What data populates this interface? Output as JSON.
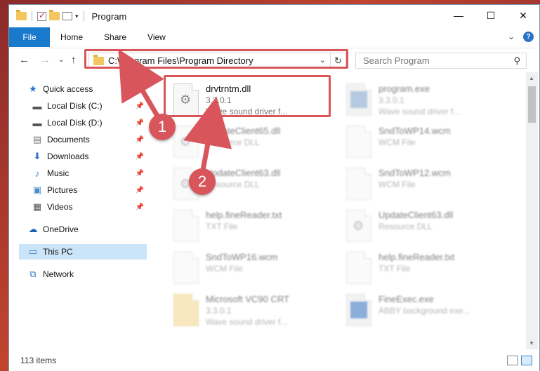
{
  "window": {
    "title": "Program",
    "controls": {
      "minimize": "—",
      "maximize": "☐",
      "close": "✕"
    }
  },
  "ribbon": {
    "file_tab": "File",
    "tabs": [
      "Home",
      "Share",
      "View"
    ]
  },
  "address": {
    "path": "C:\\Program Files\\Program Directory",
    "search_placeholder": "Search Program"
  },
  "nav": {
    "items": [
      {
        "label": "Quick access",
        "icon": "star-icon",
        "pinned": false
      },
      {
        "label": "Local Disk (C:)",
        "icon": "drive-icon",
        "pinned": true
      },
      {
        "label": "Local Disk (D:)",
        "icon": "drive-icon",
        "pinned": true
      },
      {
        "label": "Documents",
        "icon": "documents-icon",
        "pinned": true
      },
      {
        "label": "Downloads",
        "icon": "download-icon",
        "pinned": true
      },
      {
        "label": "Music",
        "icon": "music-icon",
        "pinned": true
      },
      {
        "label": "Pictures",
        "icon": "pictures-icon",
        "pinned": true
      },
      {
        "label": "Videos",
        "icon": "videos-icon",
        "pinned": true
      },
      {
        "label": "OneDrive",
        "icon": "cloud-icon",
        "pinned": false
      },
      {
        "label": "This PC",
        "icon": "computer-icon",
        "pinned": false,
        "selected": true
      },
      {
        "label": "Network",
        "icon": "network-icon",
        "pinned": false
      }
    ]
  },
  "files": [
    {
      "name": "drvtrntm.dll",
      "line2": "3.3.0.1",
      "line3": "Wave sound driver f...",
      "icon": "dll-file-icon"
    },
    {
      "name": "program.exe",
      "line2": "3.3.0.1",
      "line3": "Wave sound driver f...",
      "icon": "exe-file-icon"
    },
    {
      "name": "UpdateClient65.dll",
      "line2": "Resource DLL",
      "line3": "",
      "icon": "dll-file-icon"
    },
    {
      "name": "SndToWP14.wcm",
      "line2": "WCM File",
      "line3": "",
      "icon": "blank-file-icon"
    },
    {
      "name": "UpdateClient63.dll",
      "line2": "Resource DLL",
      "line3": "",
      "icon": "dll-file-icon"
    },
    {
      "name": "SndToWP12.wcm",
      "line2": "WCM File",
      "line3": "",
      "icon": "blank-file-icon"
    },
    {
      "name": "help.fineReader.txt",
      "line2": "TXT File",
      "line3": "",
      "icon": "blank-file-icon"
    },
    {
      "name": "UpdateClient63.dll",
      "line2": "Resource DLL",
      "line3": "",
      "icon": "dll-file-icon"
    },
    {
      "name": "SndToWP16.wcm",
      "line2": "WCM File",
      "line3": "",
      "icon": "blank-file-icon"
    },
    {
      "name": "help.fineReader.txt",
      "line2": "TXT File",
      "line3": "",
      "icon": "blank-file-icon"
    },
    {
      "name": "Microsoft VC90 CRT",
      "line2": "3.3.0.1",
      "line3": "Wave sound driver f...",
      "icon": "folder-icon"
    },
    {
      "name": "FineExec.exe",
      "line2": "ABBY background exe...",
      "line3": "",
      "icon": "exe-file-icon"
    }
  ],
  "status": {
    "items": "113 items"
  },
  "callouts": {
    "one": "1",
    "two": "2"
  },
  "colors": {
    "accent": "#1979ca",
    "callout": "#d9555c",
    "selected": "#cce4f7"
  }
}
